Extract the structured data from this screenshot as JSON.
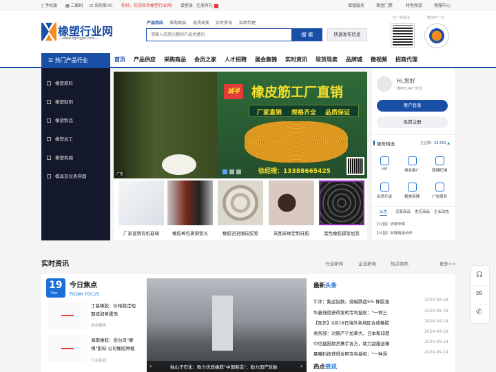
{
  "topbar": {
    "mobile": "手机版",
    "qrcode": "二维码",
    "cart": "采购单(0)",
    "welcome": "你好，欢迎来到橡塑行业网！",
    "login": "请登录",
    "register": "注册有礼",
    "links": [
      "增值服务",
      "黄金门票",
      "特色频道",
      "客服中心"
    ]
  },
  "header": {
    "logo_cn": "橡塑行业网",
    "logo_url": "—www.zgxsjypt.com—",
    "search_tabs": [
      "产品供应",
      "采购商品",
      "现货现卖",
      "实时资讯",
      "招商代理"
    ],
    "search_placeholder": "请输入您感兴趣的产品关键词",
    "search_button": "搜 索",
    "publish_button": "快速发布信息",
    "qr1_caption": "扫一扫关注",
    "qr2_caption": "微信扫一扫"
  },
  "nav": {
    "hot_category": "热门产品行业",
    "items": [
      "首页",
      "产品供应",
      "采购商品",
      "会员之家",
      "人才招聘",
      "展会集锦",
      "实时资讯",
      "现货现卖",
      "品牌城",
      "微视频",
      "招商代理"
    ]
  },
  "sidebar": {
    "items": [
      "橡塑原料",
      "橡塑助剂",
      "橡塑制品",
      "橡塑加工",
      "橡塑机械",
      "模具及仪表容器"
    ]
  },
  "banner": {
    "title_small": "诚寻",
    "title": "橡皮筋工厂直销",
    "slogans": [
      "厂家直销",
      "规格齐全",
      "品质保证"
    ],
    "contact": "徐经理：13388665425",
    "ad_tag": "广告"
  },
  "products": [
    {
      "caption": "厂家直销有机玻璃"
    },
    {
      "caption": "橡胶棒包裹钢管长"
    },
    {
      "caption": "橡胶密封圈硅胶管"
    },
    {
      "caption": "来图来样定制硅胶"
    },
    {
      "caption": "黑色橡胶脚垫加垫"
    }
  ],
  "rightpanel": {
    "greeting": "Hi,您好",
    "subgreet": "橡积分,换广告位",
    "login_button": "用户登录",
    "register_button": "免费注册",
    "service_title": "服务精选",
    "member_count_label": "企业数：",
    "member_count": "33,563",
    "services": [
      "VIP",
      "排名推广",
      "商铺旺铺",
      "会员升级",
      "精美商铺",
      "广告服务"
    ],
    "tabs": [
      "公告",
      "买家商品",
      "供应商品",
      "企业动态"
    ],
    "notices": [
      "【公告】法律申明",
      "【公告】友情链接合作"
    ]
  },
  "news": {
    "section_title": "实时资讯",
    "tabs": [
      "行业新闻",
      "企业新闻",
      "热点聚焦"
    ],
    "more": "更多>>",
    "date_day": "19",
    "date_month": "Dec",
    "today_title": "今日焦点",
    "today_sub": "TODAY FOCUS",
    "focus_items": [
      {
        "title": "丁基橡胶：价格稳定短期或弱势震荡",
        "tag": "热点聚焦"
      },
      {
        "title": "海南橡胶：受台风\"摩羯\"影响 公司橡胶种植",
        "tag": "行业新闻"
      }
    ],
    "image_caption": "独山子石化：致力优质橡胶\"中国制造\"，助力国产轮胎",
    "latest_title_a": "最新",
    "latest_title_b": "头条",
    "latest": [
      {
        "title": "午评：集运指数，烧碱跌超5% 橡胶涨",
        "date": "2024-09-18"
      },
      {
        "title": "华菱线缆获得发明专利授权：\"一种三",
        "date": "2024-09-18"
      },
      {
        "title": "【现货】9月18日海外各地区合成橡胶",
        "date": "2024-09-18"
      },
      {
        "title": "商务部：对原产于加拿大、日本和印度",
        "date": "2024-09-18"
      },
      {
        "title": "中信建投期货携手各方，助力勐腊县橡",
        "date": "2024-09-14"
      },
      {
        "title": "晨曦科技获得发明专利授权：\"一种涡",
        "date": "2024-09-14"
      }
    ],
    "hot_title_a": "热点",
    "hot_title_b": "资讯"
  },
  "colors": {
    "brand_blue": "#1a4fa8",
    "nav_dark": "#14182b",
    "accent_red": "#e23b3b",
    "banner_yellow": "#f7e02a"
  }
}
